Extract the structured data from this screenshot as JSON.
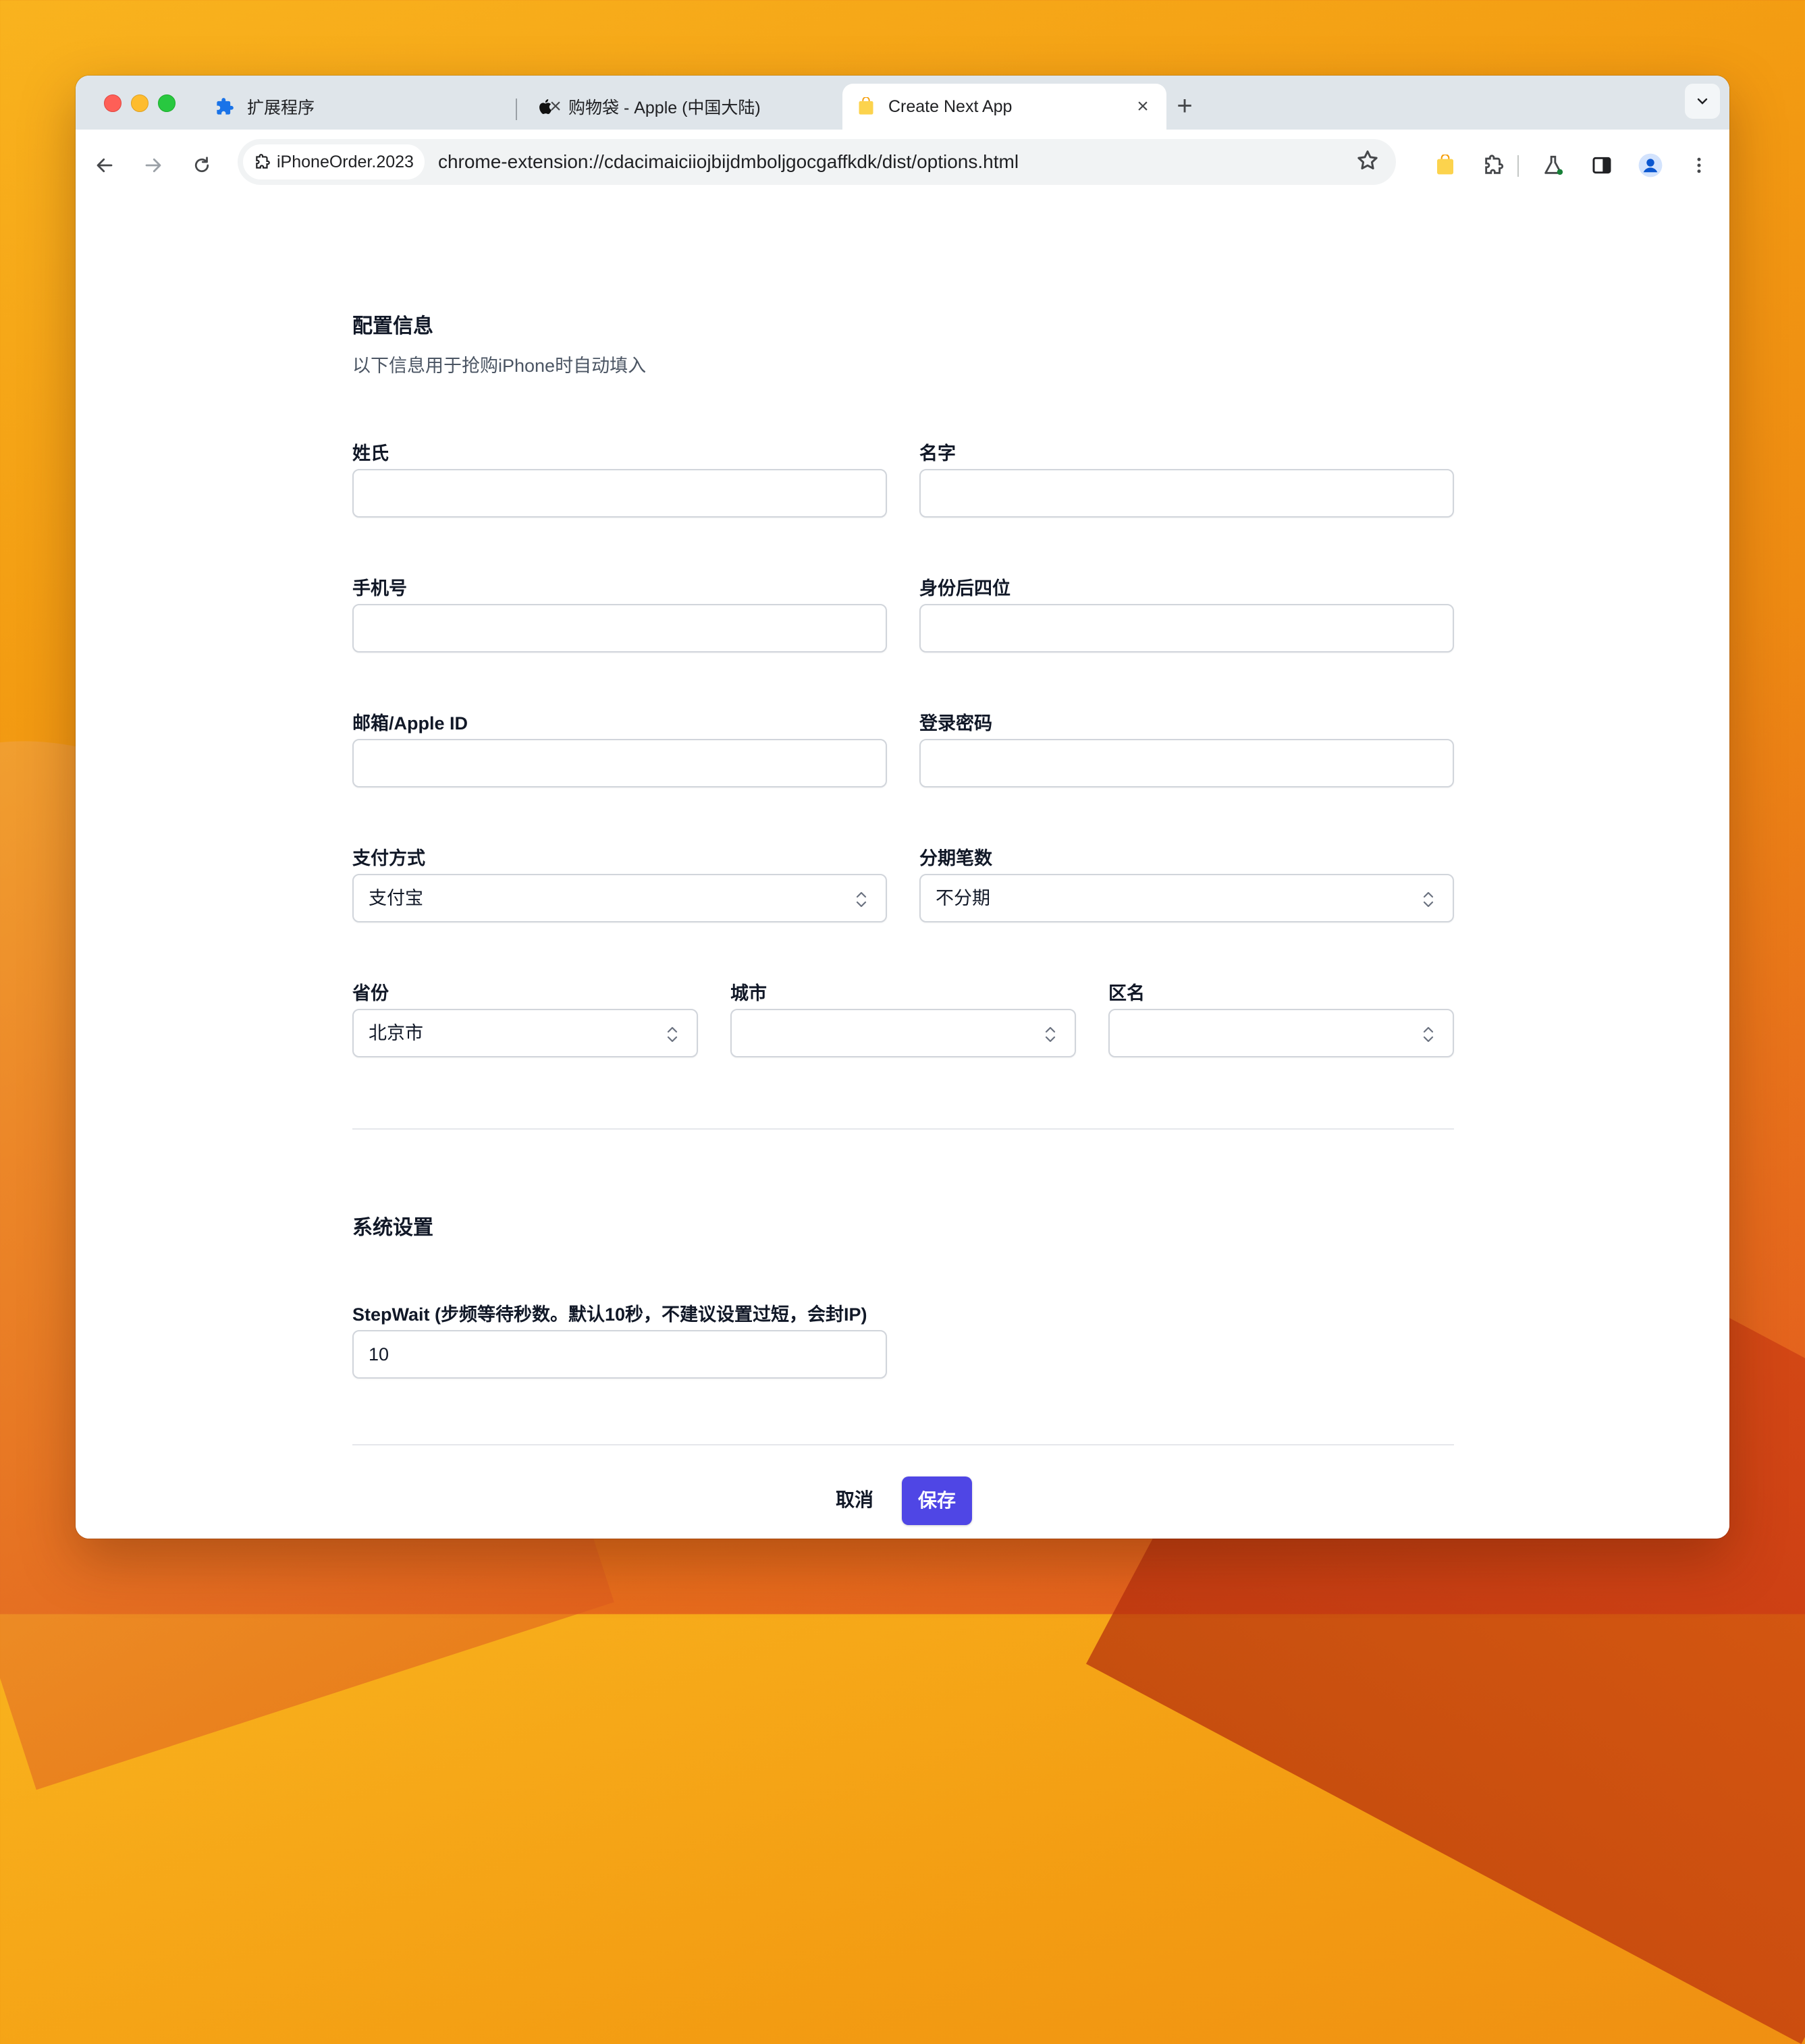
{
  "browser": {
    "tabs": [
      {
        "title": "扩展程序",
        "icon": "puzzle-icon"
      },
      {
        "title": "购物袋 - Apple (中国大陆)",
        "icon": "apple-icon"
      },
      {
        "title": "Create Next App",
        "icon": "bag-icon",
        "active": true
      }
    ],
    "new_tab": "+",
    "site_chip": "iPhoneOrder.2023",
    "url": "chrome-extension://cdacimaiciiojbijdmboljgocgaffkdk/dist/options.html"
  },
  "config": {
    "title": "配置信息",
    "description": "以下信息用于抢购iPhone时自动填入",
    "fields": {
      "last_name": {
        "label": "姓氏",
        "value": ""
      },
      "first_name": {
        "label": "名字",
        "value": ""
      },
      "phone": {
        "label": "手机号",
        "value": ""
      },
      "id_last4": {
        "label": "身份后四位",
        "value": ""
      },
      "email": {
        "label": "邮箱/Apple ID",
        "value": ""
      },
      "password": {
        "label": "登录密码",
        "value": ""
      },
      "payment": {
        "label": "支付方式",
        "value": "支付宝"
      },
      "installments": {
        "label": "分期笔数",
        "value": "不分期"
      },
      "province": {
        "label": "省份",
        "value": "北京市"
      },
      "city": {
        "label": "城市",
        "value": ""
      },
      "district": {
        "label": "区名",
        "value": ""
      }
    }
  },
  "system": {
    "title": "系统设置",
    "stepwait": {
      "label": "StepWait (步频等待秒数。默认10秒，不建议设置过短，会封IP)",
      "value": "10"
    }
  },
  "actions": {
    "cancel": "取消",
    "save": "保存"
  },
  "colors": {
    "accent": "#4f46e5",
    "border": "#d1d5db",
    "heading": "#111827"
  }
}
